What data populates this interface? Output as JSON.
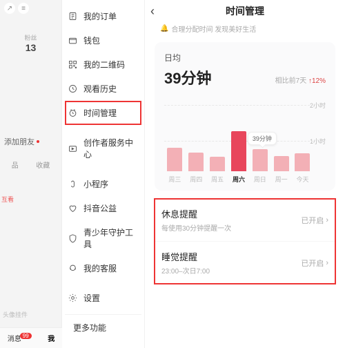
{
  "profile": {
    "followers_label": "粉丝",
    "followers_count": "13",
    "add_friend": "添加朋友",
    "tab_works": "品",
    "tab_collect": "收藏",
    "pill": "互看",
    "avatar_hint": "头像挂件",
    "nav_msg": "消息",
    "nav_msg_badge": "99",
    "nav_me": "我"
  },
  "drawer": {
    "items": [
      {
        "icon": "orders",
        "label": "我的订单"
      },
      {
        "icon": "wallet",
        "label": "钱包"
      },
      {
        "icon": "qrcode",
        "label": "我的二维码"
      },
      {
        "icon": "history",
        "label": "观看历史"
      },
      {
        "icon": "clock",
        "label": "时间管理",
        "highlight": true
      },
      {
        "icon": "creator",
        "label": "创作者服务中心"
      },
      {
        "icon": "mini",
        "label": "小程序"
      },
      {
        "icon": "charity",
        "label": "抖音公益"
      },
      {
        "icon": "teen",
        "label": "青少年守护工具"
      },
      {
        "icon": "service",
        "label": "我的客服"
      },
      {
        "icon": "settings",
        "label": "设置"
      }
    ],
    "more": "更多功能"
  },
  "panel": {
    "title": "时间管理",
    "subtitle": "合理分配时间 发现美好生活",
    "daily_label": "日均",
    "daily_value": "39分钟",
    "compare_prefix": "相比前7天",
    "compare_delta": "↑12%",
    "chart_data": {
      "type": "bar",
      "unit": "分钟",
      "y_ticks": [
        "2小时",
        "1小时"
      ],
      "y_max_minutes": 120,
      "categories": [
        "周三",
        "周四",
        "周五",
        "周六",
        "周日",
        "周一",
        "今天"
      ],
      "values": [
        41,
        33,
        25,
        70,
        39,
        27,
        31
      ],
      "highlight_index": 3,
      "tooltip_index": 4,
      "tooltip_text": "39分钟",
      "bar_color": "#f3b0b6",
      "bar_highlight_color": "#e8465c"
    },
    "reminders": [
      {
        "title": "休息提醒",
        "desc": "每使用30分钟提醒一次",
        "status": "已开启"
      },
      {
        "title": "睡觉提醒",
        "desc": "23:00–次日7:00",
        "status": "已开启"
      }
    ]
  }
}
